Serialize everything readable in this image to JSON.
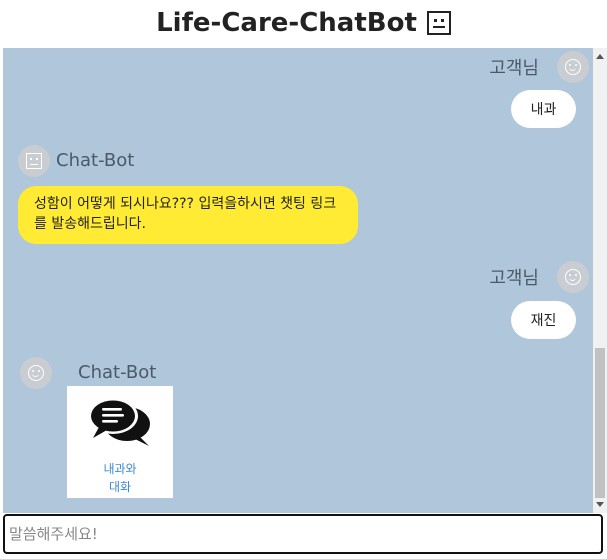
{
  "app": {
    "title": "Life-Care-ChatBot"
  },
  "messages": [
    {
      "sender": "고객님",
      "type": "user",
      "text": "내과"
    },
    {
      "sender": "Chat-Bot",
      "type": "bot",
      "text": "성함이 어떻게 되시나요??? 입력을하시면 챗팅 링크를 발송해드립니다."
    },
    {
      "sender": "고객님",
      "type": "user",
      "text": "재진"
    },
    {
      "sender": "Chat-Bot",
      "type": "bot-card",
      "card_label_line1": "내과와",
      "card_label_line2": "대화"
    }
  ],
  "input": {
    "placeholder": "말씀해주세요!"
  },
  "colors": {
    "chat_bg": "#b0c6da",
    "bot_bubble": "#ffeb33",
    "user_bubble": "#ffffff",
    "card_link": "#3d8ad6"
  }
}
